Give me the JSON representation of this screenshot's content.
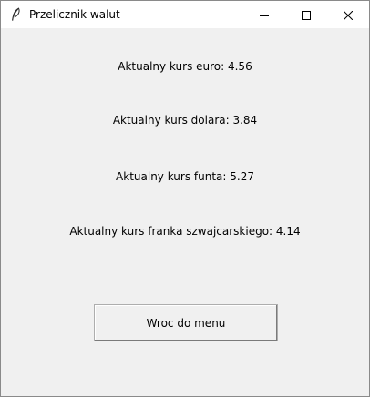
{
  "window": {
    "title": "Przelicznik walut",
    "icon": "feather-icon"
  },
  "caption_buttons": {
    "minimize_icon": "minimize-icon",
    "maximize_icon": "maximize-icon",
    "close_icon": "close-icon"
  },
  "rates": {
    "euro": "Aktualny kurs euro: 4.56",
    "dolar": "Aktualny kurs dolara: 3.84",
    "funt": "Aktualny kurs funta: 5.27",
    "frank": "Aktualny kurs franka szwajcarskiego: 4.14"
  },
  "actions": {
    "back_label": "Wroc do menu"
  }
}
